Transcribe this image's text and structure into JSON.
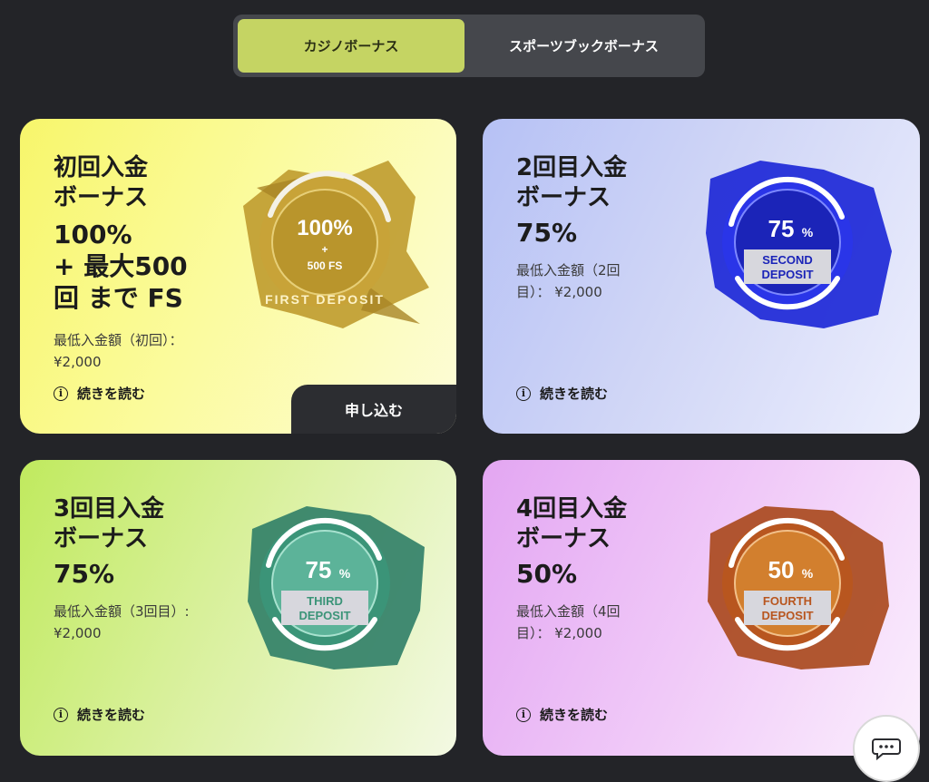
{
  "tabs": {
    "casino": "カジノボーナス",
    "sports": "スポーツブックボーナス"
  },
  "cards": [
    {
      "title": "初回入金\nボーナス",
      "headline": "100%\n+ 最大500\n回 まで FS",
      "min_deposit": "最低入金額（初回）： ¥2,000",
      "read_more": "続きを読む",
      "apply": "申し込む",
      "badge": {
        "value": "100%",
        "plus": "+",
        "extra": "500 FS",
        "caption": "FIRST DEPOSIT",
        "color": "#c9a432"
      }
    },
    {
      "title": "2回目入金\nボーナス",
      "headline": "75%",
      "min_deposit": "最低入金額（2回目）： ¥2,000",
      "read_more": "続きを読む",
      "badge": {
        "value": "75",
        "unit": "%",
        "caption1": "SECOND",
        "caption2": "DEPOSIT",
        "color": "#1d2bd9"
      }
    },
    {
      "title": "3回目入金\nボーナス",
      "headline": "75%",
      "min_deposit": "最低入金額（3回目）: ¥2,000",
      "read_more": "続きを読む",
      "badge": {
        "value": "75",
        "unit": "%",
        "caption1": "THIRD",
        "caption2": "DEPOSIT",
        "color": "#3f9c7f"
      }
    },
    {
      "title": "4回目入金\nボーナス",
      "headline": "50%",
      "min_deposit": "最低入金額（4回目）： ¥2,000",
      "read_more": "続きを読む",
      "badge": {
        "value": "50",
        "unit": "%",
        "caption1": "FOURTH",
        "caption2": "DEPOSIT",
        "color": "#b8561f"
      }
    }
  ],
  "chat": {
    "icon": "chat-bubble-icon"
  }
}
